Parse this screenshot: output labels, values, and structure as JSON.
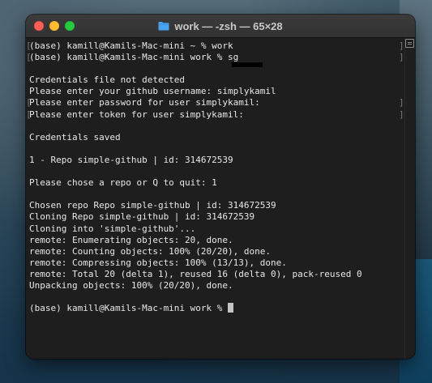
{
  "window": {
    "title": "work — -zsh — 65×28"
  },
  "terminal": {
    "lines": [
      {
        "text": "(base) kamill@Kamils-Mac-mini ~ % work",
        "bracket": true
      },
      {
        "text": "(base) kamill@Kamils-Mac-mini work % sg",
        "bracket": true,
        "redacted": true
      },
      {
        "text": "",
        "bracket": false
      },
      {
        "text": "Credentials file not detected",
        "bracket": false
      },
      {
        "text": "Please enter your github username: simplykamil",
        "bracket": false
      },
      {
        "text": "Please enter password for user simplykamil:",
        "bracket": true
      },
      {
        "text": "Please enter token for user simplykamil:",
        "bracket": true
      },
      {
        "text": "",
        "bracket": false
      },
      {
        "text": "Credentials saved",
        "bracket": false
      },
      {
        "text": "",
        "bracket": false
      },
      {
        "text": "1 - Repo simple-github | id: 314672539",
        "bracket": false
      },
      {
        "text": "",
        "bracket": false
      },
      {
        "text": "Please chose a repo or Q to quit: 1",
        "bracket": false
      },
      {
        "text": "",
        "bracket": false
      },
      {
        "text": "Chosen repo Repo simple-github | id: 314672539",
        "bracket": false
      },
      {
        "text": "Cloning Repo simple-github | id: 314672539",
        "bracket": false
      },
      {
        "text": "Cloning into 'simple-github'...",
        "bracket": false
      },
      {
        "text": "remote: Enumerating objects: 20, done.",
        "bracket": false
      },
      {
        "text": "remote: Counting objects: 100% (20/20), done.",
        "bracket": false
      },
      {
        "text": "remote: Compressing objects: 100% (13/13), done.",
        "bracket": false
      },
      {
        "text": "remote: Total 20 (delta 1), reused 16 (delta 0), pack-reused 0",
        "bracket": false
      },
      {
        "text": "Unpacking objects: 100% (20/20), done.",
        "bracket": false
      },
      {
        "text": "",
        "bracket": false
      },
      {
        "text": "(base) kamill@Kamils-Mac-mini work % ",
        "bracket": false,
        "cursor": true
      }
    ]
  },
  "colors": {
    "background": "#1e1e1e",
    "text": "#e8e8e8",
    "close": "#ff5f57",
    "minimize": "#febc2e",
    "zoom": "#28c840",
    "folder": "#4aa3f0"
  },
  "icons": {
    "title_icon": "folder-icon",
    "scroll_corner": "scroll-indicator-icon"
  }
}
